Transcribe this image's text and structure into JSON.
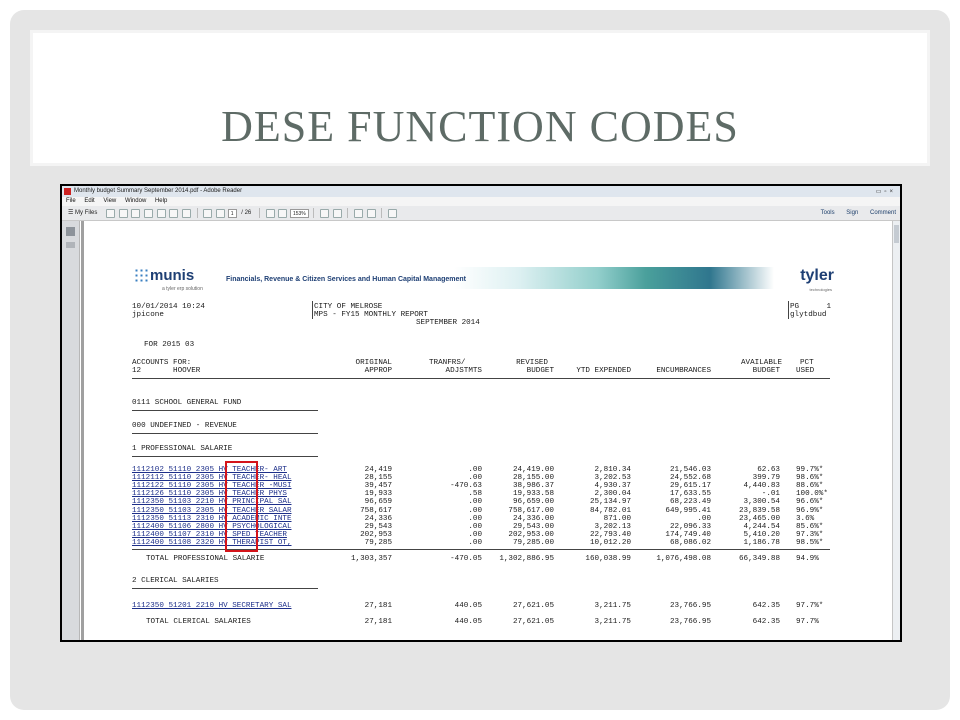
{
  "slide": {
    "title": "DESE FUNCTION CODES"
  },
  "reader": {
    "window_title": "Monthly budget Summary September 2014.pdf - Adobe Reader",
    "menu": [
      "File",
      "Edit",
      "View",
      "Window",
      "Help"
    ],
    "my_files_label": "My Files",
    "page_current": "1",
    "page_total": "/ 26",
    "zoom": "153%",
    "right_tools": [
      "Tools",
      "Sign",
      "Comment"
    ]
  },
  "report": {
    "munis_logo": "munis",
    "munis_tagline": "a tyler erp solution",
    "banner_title": "Financials, Revenue & Citizen Services and Human Capital Management",
    "tyler_logo": "tyler",
    "tyler_tagline": "technologies",
    "datetime": "10/01/2014 10:24",
    "user": "jpicone",
    "city": "CITY OF MELROSE",
    "report_name": "MPS - FY15 MONTHLY REPORT",
    "month": "SEPTEMBER 2014",
    "page_label": "PG      1",
    "report_code": "glytdbud",
    "for_period": "FOR 2015 03",
    "col_accounts_line1": "ACCOUNTS FOR:",
    "col_accounts_line2": "12       HOOVER",
    "col_original_1": "ORIGINAL",
    "col_original_2": "APPROP",
    "col_tranfrs_1": "TRANFRS/",
    "col_tranfrs_2": "ADJSTMTS",
    "col_revised_1": "REVISED",
    "col_revised_2": "BUDGET",
    "col_ytd": "YTD EXPENDED",
    "col_enc": "ENCUMBRANCES",
    "col_available_1": "AVAILABLE",
    "col_available_2": "BUDGET",
    "col_pct_1": "PCT",
    "col_pct_2": "USED",
    "fund": "0111 SCHOOL GENERAL FUND",
    "undefined": "000 UNDEFINED - REVENUE",
    "section1": "1 PROFESSIONAL SALARIE",
    "rows1": [
      {
        "acct": "1112102 51110 2305 HV TEACHER- ART",
        "orig": "24,419",
        "adj": ".00",
        "rev": "24,419.00",
        "ytd": "2,810.34",
        "enc": "21,546.03",
        "avail": "62.63",
        "pct": "99.7%*"
      },
      {
        "acct": "1112112 51110 2305 HV TEACHER- HEAL",
        "orig": "28,155",
        "adj": ".00",
        "rev": "28,155.00",
        "ytd": "3,202.53",
        "enc": "24,552.68",
        "avail": "399.79",
        "pct": "98.6%*"
      },
      {
        "acct": "1112122 51110 2305 HV TEACHER -MUSI",
        "orig": "39,457",
        "adj": "-470.63",
        "rev": "38,986.37",
        "ytd": "4,930.37",
        "enc": "29,615.17",
        "avail": "4,440.83",
        "pct": "88.6%*"
      },
      {
        "acct": "1112126 51110 2305 HV TEACHER PHYS",
        "orig": "19,933",
        "adj": ".58",
        "rev": "19,933.58",
        "ytd": "2,300.04",
        "enc": "17,633.55",
        "avail": "-.01",
        "pct": "100.0%*"
      },
      {
        "acct": "1112350 51103 2210 HV PRINCIPAL SAL",
        "orig": "96,659",
        "adj": ".00",
        "rev": "96,659.00",
        "ytd": "25,134.97",
        "enc": "68,223.49",
        "avail": "3,300.54",
        "pct": "96.6%*"
      },
      {
        "acct": "1112350 51103 2305 HV TEACHER SALAR",
        "orig": "758,617",
        "adj": ".00",
        "rev": "758,617.00",
        "ytd": "84,782.01",
        "enc": "649,995.41",
        "avail": "23,839.58",
        "pct": "96.9%*"
      },
      {
        "acct": "1112350 51113 2310 HV ACADEMIC INTE",
        "orig": "24,336",
        "adj": ".00",
        "rev": "24,336.00",
        "ytd": "871.00",
        "enc": ".00",
        "avail": "23,465.00",
        "pct": "3.6%"
      },
      {
        "acct": "1112400 51106 2800 HV PSYCHOLOGICAL",
        "orig": "29,543",
        "adj": ".00",
        "rev": "29,543.00",
        "ytd": "3,202.13",
        "enc": "22,096.33",
        "avail": "4,244.54",
        "pct": "85.6%*"
      },
      {
        "acct": "1112400 51107 2310 HV SPED TEACHER",
        "orig": "202,953",
        "adj": ".00",
        "rev": "202,953.00",
        "ytd": "22,793.40",
        "enc": "174,749.40",
        "avail": "5,410.20",
        "pct": "97.3%*"
      },
      {
        "acct": "1112400 51108 2320 HV THERAPIST OT,",
        "orig": "79,285",
        "adj": ".00",
        "rev": "79,285.00",
        "ytd": "10,012.20",
        "enc": "68,086.02",
        "avail": "1,186.78",
        "pct": "98.5%*"
      }
    ],
    "total1": {
      "label": "TOTAL PROFESSIONAL SALARIE",
      "orig": "1,303,357",
      "adj": "-470.05",
      "rev": "1,302,886.95",
      "ytd": "160,038.99",
      "enc": "1,076,498.08",
      "avail": "66,349.88",
      "pct": "94.9%"
    },
    "section2": "2 CLERICAL SALARIES",
    "rows2": [
      {
        "acct": "1112350 51201 2210 HV SECRETARY SAL",
        "orig": "27,181",
        "adj": "440.05",
        "rev": "27,621.05",
        "ytd": "3,211.75",
        "enc": "23,766.95",
        "avail": "642.35",
        "pct": "97.7%*"
      }
    ],
    "total2": {
      "label": "TOTAL CLERICAL SALARIES",
      "orig": "27,181",
      "adj": "440.05",
      "rev": "27,621.05",
      "ytd": "3,211.75",
      "enc": "23,766.95",
      "avail": "642.35",
      "pct": "97.7%"
    }
  },
  "colors": {
    "title": "#5e6b66",
    "highlight": "#d4141a",
    "link": "#1d2f8a"
  }
}
